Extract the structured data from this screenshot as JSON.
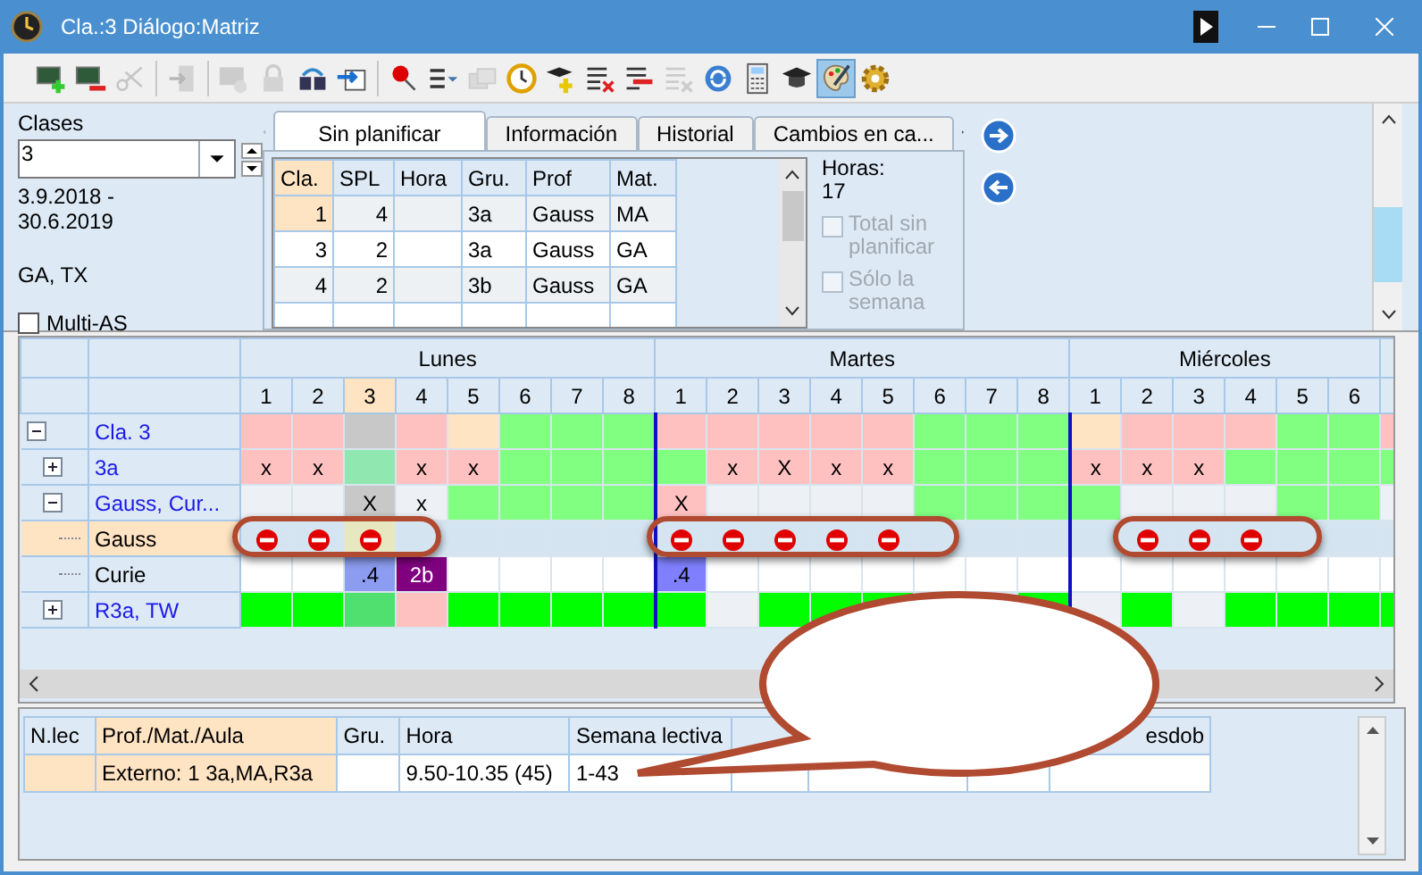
{
  "window": {
    "title": "Cla.:3  Diálogo:Matriz"
  },
  "toolbar": [
    {
      "disabled": false,
      "selected": false
    },
    {
      "disabled": false,
      "selected": false
    },
    {
      "disabled": true,
      "selected": false
    },
    {
      "disabled": true,
      "selected": false
    },
    {
      "disabled": true,
      "selected": false
    },
    {
      "disabled": true,
      "selected": false
    },
    {
      "disabled": false,
      "selected": false
    },
    {
      "disabled": false,
      "selected": false
    },
    {
      "disabled": false,
      "selected": false
    },
    {
      "disabled": false,
      "selected": false
    },
    {
      "disabled": true,
      "selected": false
    },
    {
      "disabled": false,
      "selected": false
    },
    {
      "disabled": false,
      "selected": false
    },
    {
      "disabled": false,
      "selected": false
    },
    {
      "disabled": false,
      "selected": false
    },
    {
      "disabled": true,
      "selected": false
    },
    {
      "disabled": false,
      "selected": false
    },
    {
      "disabled": false,
      "selected": false
    },
    {
      "disabled": false,
      "selected": false
    },
    {
      "disabled": false,
      "selected": true
    },
    {
      "disabled": false,
      "selected": false
    }
  ],
  "classes": {
    "label": "Clases",
    "value": "3",
    "dates": "3.9.2018 - 30.6.2019",
    "subjects": "GA, TX",
    "multi_as": {
      "label": "Multi-AS",
      "checked": false
    }
  },
  "tabs": [
    {
      "label": "Sin planificar",
      "selected": true
    },
    {
      "label": "Información",
      "selected": false
    },
    {
      "label": "Historial",
      "selected": false
    },
    {
      "label": "Cambios en ca...",
      "selected": false
    }
  ],
  "unscheduled": {
    "columns": [
      {
        "label": "Cla.",
        "selected": true
      },
      {
        "label": "SPL",
        "selected": false
      },
      {
        "label": "Hora",
        "selected": false
      },
      {
        "label": "Gru.",
        "selected": false
      },
      {
        "label": "Prof",
        "selected": false
      },
      {
        "label": "Mat.",
        "selected": false
      }
    ],
    "rows": [
      {
        "selected": true,
        "cells": [
          "1",
          "4",
          null,
          "3a",
          "Gauss",
          "MA"
        ]
      },
      {
        "selected": false,
        "cells": [
          "3",
          "2",
          null,
          "3a",
          "Gauss",
          "GA"
        ]
      },
      {
        "selected": false,
        "cells": [
          "4",
          "2",
          null,
          "3b",
          "Gauss",
          "GA"
        ]
      }
    ]
  },
  "hours": {
    "label": "Horas:",
    "value": "17"
  },
  "options": [
    {
      "label": "Total sin planificar",
      "checked": false,
      "disabled": true
    },
    {
      "label": "Sólo la semana",
      "checked": false,
      "disabled": true
    }
  ],
  "days": [
    {
      "name": "Lunes",
      "periods": [
        {
          "label": "1",
          "selected": false
        },
        {
          "label": "2",
          "selected": false
        },
        {
          "label": "3",
          "selected": true
        },
        {
          "label": "4",
          "selected": false
        },
        {
          "label": "5",
          "selected": false
        },
        {
          "label": "6",
          "selected": false
        },
        {
          "label": "7",
          "selected": false
        },
        {
          "label": "8",
          "selected": false
        }
      ]
    },
    {
      "name": "Martes",
      "periods": [
        {
          "label": "1",
          "selected": false
        },
        {
          "label": "2",
          "selected": false
        },
        {
          "label": "3",
          "selected": false
        },
        {
          "label": "4",
          "selected": false
        },
        {
          "label": "5",
          "selected": false
        },
        {
          "label": "6",
          "selected": false
        },
        {
          "label": "7",
          "selected": false
        },
        {
          "label": "8",
          "selected": false
        }
      ]
    },
    {
      "name": "Miércoles",
      "periods": [
        {
          "label": "1",
          "selected": false
        },
        {
          "label": "2",
          "selected": false
        },
        {
          "label": "3",
          "selected": false
        },
        {
          "label": "4",
          "selected": false
        },
        {
          "label": "5",
          "selected": false
        },
        {
          "label": "6",
          "selected": false
        }
      ]
    }
  ],
  "rows": [
    {
      "name": "Cla. 3",
      "expanded": true,
      "selected": false,
      "cells": [
        {
          "color": "#ffc0c0"
        },
        {
          "color": "#ffc0c0"
        },
        {
          "color": "#c8c8c8"
        },
        {
          "color": "#ffc0c0"
        },
        {
          "color": "#ffe4c4"
        },
        {
          "color": "#80ff80"
        },
        {
          "color": "#80ff80"
        },
        {
          "color": "#80ff80"
        },
        {
          "color": "#ffc0c0"
        },
        {
          "color": "#ffc0c0"
        },
        {
          "color": "#ffc0c0"
        },
        {
          "color": "#ffc0c0"
        },
        {
          "color": "#ffc0c0"
        },
        {
          "color": "#80ff80"
        },
        {
          "color": "#80ff80"
        },
        {
          "color": "#80ff80"
        },
        {
          "color": "#ffe4c4"
        },
        {
          "color": "#ffc0c0"
        },
        {
          "color": "#ffc0c0"
        },
        {
          "color": "#ffc0c0"
        },
        {
          "color": "#80ff80"
        },
        {
          "color": "#80ff80"
        },
        {
          "color": "#ffc0c0"
        }
      ],
      "children": [
        {
          "name": "3a",
          "expanded": false,
          "selected": false,
          "cells": [
            {
              "color": "#ffc0c0",
              "text": "x"
            },
            {
              "color": "#ffc0c0",
              "text": "x"
            },
            {
              "color": "#90e8b0"
            },
            {
              "color": "#ffc0c0",
              "text": "x"
            },
            {
              "color": "#ffc0c0",
              "text": "x"
            },
            {
              "color": "#80ff80"
            },
            {
              "color": "#80ff80"
            },
            {
              "color": "#80ff80"
            },
            {
              "color": "#80ff80"
            },
            {
              "color": "#ffc0c0",
              "text": "x"
            },
            {
              "color": "#ffc0c0",
              "text": "X"
            },
            {
              "color": "#ffc0c0",
              "text": "x"
            },
            {
              "color": "#ffc0c0",
              "text": "x"
            },
            {
              "color": "#80ff80"
            },
            {
              "color": "#80ff80"
            },
            {
              "color": "#80ff80"
            },
            {
              "color": "#ffc0c0",
              "text": "x"
            },
            {
              "color": "#ffc0c0",
              "text": "x"
            },
            {
              "color": "#ffc0c0",
              "text": "x"
            },
            {
              "color": "#80ff80"
            },
            {
              "color": "#80ff80"
            },
            {
              "color": "#80ff80"
            },
            {
              "color": "#80ff80"
            }
          ]
        },
        {
          "name": "Gauss, Cur...",
          "expanded": true,
          "selected": false,
          "cells": [
            {
              "color": "#edf1f5"
            },
            {
              "color": "#edf1f5"
            },
            {
              "color": "#c8c8c8",
              "text": "X"
            },
            {
              "color": "#edf1f5",
              "text": "x"
            },
            {
              "color": "#80ff80"
            },
            {
              "color": "#80ff80"
            },
            {
              "color": "#80ff80"
            },
            {
              "color": "#80ff80"
            },
            {
              "color": "#ffc0c0",
              "text": "X"
            },
            {
              "color": "#edf1f5"
            },
            {
              "color": "#edf1f5"
            },
            {
              "color": "#edf1f5"
            },
            {
              "color": "#edf1f5"
            },
            {
              "color": "#80ff80"
            },
            {
              "color": "#80ff80"
            },
            {
              "color": "#80ff80"
            },
            {
              "color": "#80ff80"
            },
            {
              "color": "#edf1f5"
            },
            {
              "color": "#edf1f5"
            },
            {
              "color": "#edf1f5"
            },
            {
              "color": "#80ff80"
            },
            {
              "color": "#80ff80"
            },
            {
              "color": "#edf1f5"
            }
          ],
          "children": [
            {
              "name": "Gauss",
              "selected": true,
              "cells": [
                {
                  "color": "#d4e4f0",
                  "blocked": true
                },
                {
                  "color": "#d4e4f0",
                  "blocked": true
                },
                {
                  "color": "#e8e8c0",
                  "blocked": true
                },
                {
                  "color": "#d4e4f0",
                  "blocked": false
                },
                {
                  "color": "#d4e4f0",
                  "blocked": false
                },
                {
                  "color": "#d4e4f0",
                  "blocked": false
                },
                {
                  "color": "#d4e4f0",
                  "blocked": false
                },
                {
                  "color": "#d4e4f0",
                  "blocked": false
                },
                {
                  "color": "#d4e4f0",
                  "blocked": true
                },
                {
                  "color": "#d4e4f0",
                  "blocked": true
                },
                {
                  "color": "#d4e4f0",
                  "blocked": true
                },
                {
                  "color": "#d4e4f0",
                  "blocked": true
                },
                {
                  "color": "#d4e4f0",
                  "blocked": true
                },
                {
                  "color": "#d4e4f0",
                  "blocked": false
                },
                {
                  "color": "#d4e4f0",
                  "blocked": false
                },
                {
                  "color": "#d4e4f0",
                  "blocked": false
                },
                {
                  "color": "#d4e4f0",
                  "blocked": false
                },
                {
                  "color": "#d4e4f0",
                  "blocked": true
                },
                {
                  "color": "#d4e4f0",
                  "blocked": true
                },
                {
                  "color": "#d4e4f0",
                  "blocked": true
                },
                {
                  "color": "#d4e4f0",
                  "blocked": false
                },
                {
                  "color": "#d4e4f0",
                  "blocked": false
                },
                {
                  "color": "#d4e4f0",
                  "blocked": false
                }
              ]
            },
            {
              "name": "Curie",
              "selected": false,
              "cells": [
                {
                  "color": "#ffffff"
                },
                {
                  "color": "#ffffff"
                },
                {
                  "color": "#8c9cf0",
                  "text": ".4"
                },
                {
                  "color": "#800080",
                  "text": "2b"
                },
                {
                  "color": "#ffffff"
                },
                {
                  "color": "#ffffff"
                },
                {
                  "color": "#ffffff"
                },
                {
                  "color": "#ffffff"
                },
                {
                  "color": "#8080ff",
                  "text": ".4"
                },
                {
                  "color": "#ffffff"
                },
                {
                  "color": "#ffffff"
                },
                {
                  "color": "#ffffff"
                },
                {
                  "color": "#ffffff"
                },
                {
                  "color": "#ffffff"
                },
                {
                  "color": "#ffffff"
                },
                {
                  "color": "#ffffff"
                },
                {
                  "color": "#ffffff"
                },
                {
                  "color": "#ffffff"
                },
                {
                  "color": "#ffffff"
                },
                {
                  "color": "#ffffff"
                },
                {
                  "color": "#ffffff"
                },
                {
                  "color": "#ffffff"
                },
                {
                  "color": "#ffffff"
                }
              ]
            }
          ]
        },
        {
          "name": "R3a, TW",
          "expanded": false,
          "selected": false,
          "cells": [
            {
              "color": "#00ff00"
            },
            {
              "color": "#00ff00"
            },
            {
              "color": "#50e070"
            },
            {
              "color": "#ffc0c0"
            },
            {
              "color": "#00ff00"
            },
            {
              "color": "#00ff00"
            },
            {
              "color": "#00ff00"
            },
            {
              "color": "#00ff00"
            },
            {
              "color": "#00ff00"
            },
            {
              "color": "#edf1f5"
            },
            {
              "color": "#00ff00"
            },
            {
              "color": "#00ff00"
            },
            {
              "color": "#00ff00"
            },
            {},
            {},
            {
              "color": "#00ff00"
            },
            {
              "color": "#edf1f5"
            },
            {
              "color": "#00ff00"
            },
            {
              "color": "#edf1f5"
            },
            {
              "color": "#00ff00"
            },
            {
              "color": "#00ff00"
            },
            {
              "color": "#00ff00"
            },
            {
              "color": "#00ff00"
            }
          ]
        }
      ]
    }
  ],
  "lessons": {
    "columns": [
      {
        "label": "N.lec",
        "selected": false
      },
      {
        "label": "Prof./Mat./Aula",
        "selected": true
      },
      {
        "label": "Gru.",
        "selected": false
      },
      {
        "label": "Hora",
        "selected": false
      },
      {
        "label": "Semana lectiva",
        "selected": false
      },
      {
        "label": "esdob",
        "selected": false
      }
    ],
    "rows": [
      {
        "selected": true,
        "cells": [
          null,
          "Externo: 1 3a,MA,R3a",
          null,
          "9.50-10.35 (45)",
          "1-43",
          null
        ]
      }
    ]
  }
}
